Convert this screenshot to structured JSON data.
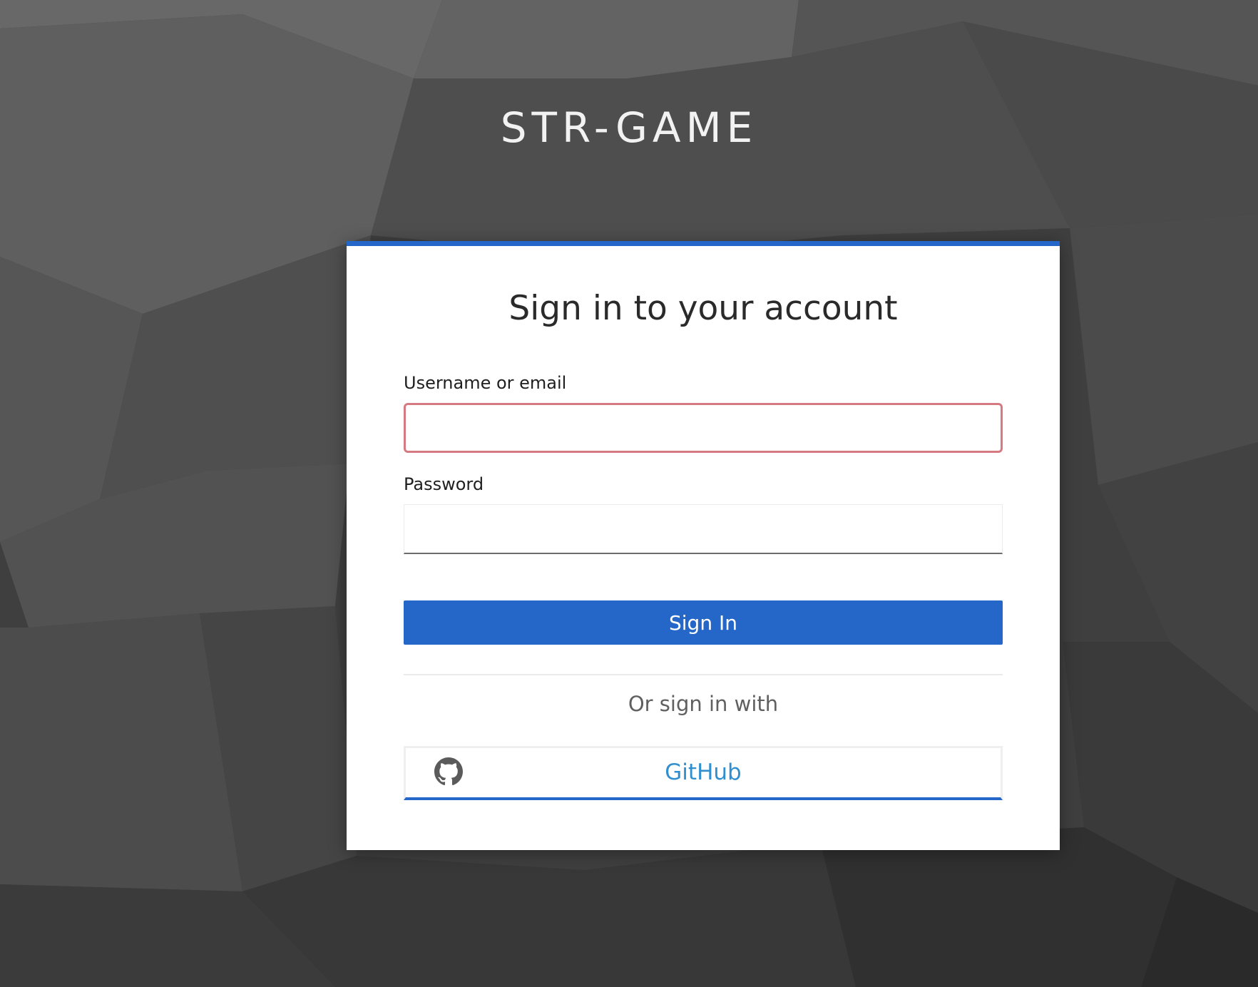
{
  "brand": {
    "title": "STR-GAME"
  },
  "login": {
    "heading": "Sign in to your account",
    "username_label": "Username or email",
    "username_value": "",
    "password_label": "Password",
    "password_value": "",
    "submit_label": "Sign In",
    "alt_text": "Or sign in with",
    "providers": [
      {
        "label": "GitHub",
        "icon": "github-icon"
      }
    ]
  },
  "colors": {
    "accent": "#2467c8",
    "error_border": "#d57a80",
    "provider_text": "#2f8fcf",
    "background": "#3f3f3f"
  }
}
